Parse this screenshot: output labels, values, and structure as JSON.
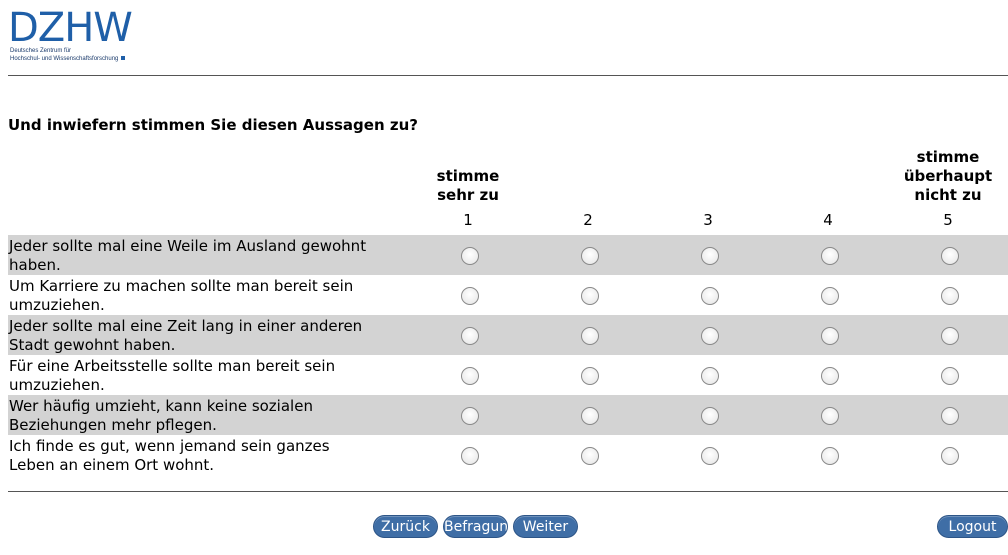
{
  "logo": {
    "text": "DZHW",
    "subtitle_line1": "Deutsches Zentrum für",
    "subtitle_line2": "Hochschul- und Wissenschaftsforschung"
  },
  "question": "Und inwiefern stimmen Sie diesen Aussagen zu?",
  "scale": {
    "left_anchor": [
      "stimme",
      "sehr zu"
    ],
    "right_anchor": [
      "stimme",
      "überhaupt",
      "nicht zu"
    ],
    "points": [
      "1",
      "2",
      "3",
      "4",
      "5"
    ]
  },
  "items": [
    {
      "line1": "Jeder sollte mal eine Weile im Ausland gewohnt",
      "line2": "haben."
    },
    {
      "line1": "Um Karriere zu machen sollte man bereit sein",
      "line2": "umzuziehen."
    },
    {
      "line1": "Jeder sollte mal eine Zeit lang in einer anderen",
      "line2": "Stadt gewohnt haben."
    },
    {
      "line1": "Für eine Arbeitsstelle sollte man bereit sein",
      "line2": "umzuziehen."
    },
    {
      "line1": "Wer häufig umzieht, kann keine sozialen",
      "line2": "Beziehungen mehr pflegen."
    },
    {
      "line1": "Ich finde es gut, wenn jemand sein ganzes",
      "line2": "Leben an einem Ort wohnt."
    }
  ],
  "buttons": {
    "back": "Zurück",
    "survey": "Befragung",
    "next": "Weiter",
    "logout": "Logout"
  },
  "colors": {
    "brand": "#1f5fa8",
    "button": "#3f6ea6",
    "row_shade": "#d3d3d3"
  }
}
